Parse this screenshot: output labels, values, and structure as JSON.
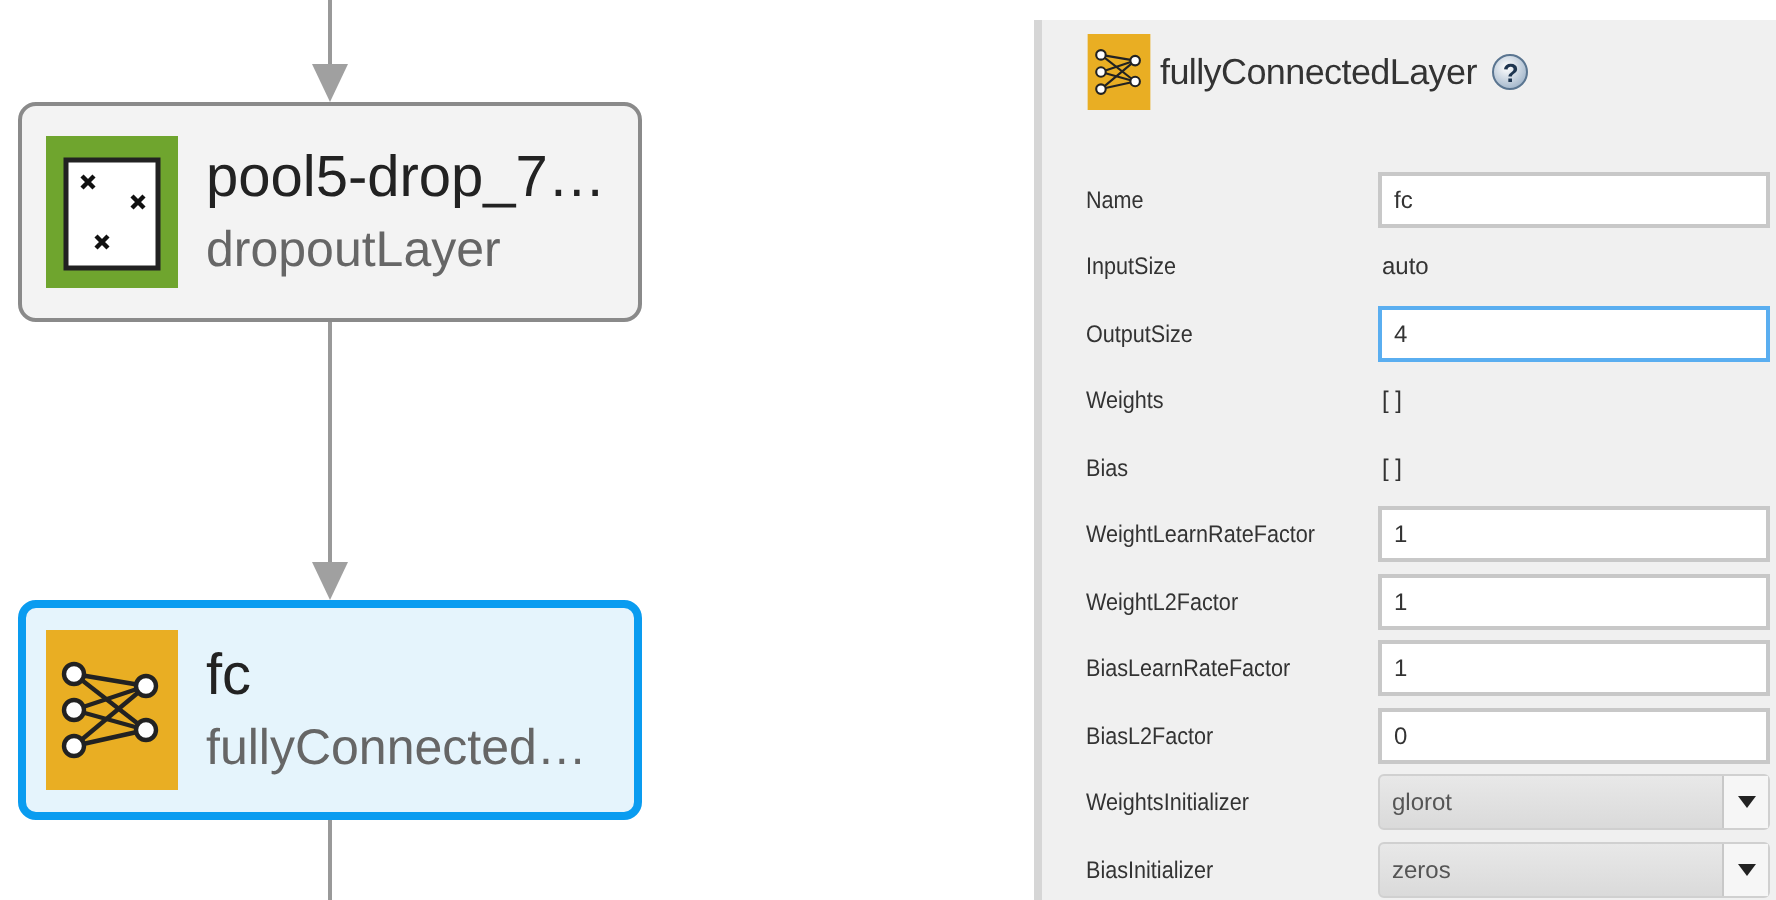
{
  "canvas": {
    "nodes": [
      {
        "name": "pool5-drop_7…",
        "type": "dropoutLayer",
        "kind": "dropout",
        "selected": false
      },
      {
        "name": "fc",
        "type": "fullyConnected…",
        "kind": "fully_connected",
        "selected": true
      }
    ]
  },
  "properties": {
    "title": "fullyConnectedLayer",
    "help": "?",
    "kind": "fully_connected",
    "rows": [
      {
        "label": "Name",
        "kind": "input",
        "value": "fc",
        "focused": false
      },
      {
        "label": "InputSize",
        "kind": "text",
        "value": "auto"
      },
      {
        "label": "OutputSize",
        "kind": "input",
        "value": "4",
        "focused": true
      },
      {
        "label": "Weights",
        "kind": "text",
        "value": "[ ]"
      },
      {
        "label": "Bias",
        "kind": "text",
        "value": "[ ]"
      },
      {
        "label": "WeightLearnRateFactor",
        "kind": "input",
        "value": "1",
        "focused": false
      },
      {
        "label": "WeightL2Factor",
        "kind": "input",
        "value": "1",
        "focused": false
      },
      {
        "label": "BiasLearnRateFactor",
        "kind": "input",
        "value": "1",
        "focused": false
      },
      {
        "label": "BiasL2Factor",
        "kind": "input",
        "value": "0",
        "focused": false
      },
      {
        "label": "WeightsInitializer",
        "kind": "dropdown",
        "value": "glorot"
      },
      {
        "label": "BiasInitializer",
        "kind": "dropdown",
        "value": "zeros"
      }
    ]
  }
}
